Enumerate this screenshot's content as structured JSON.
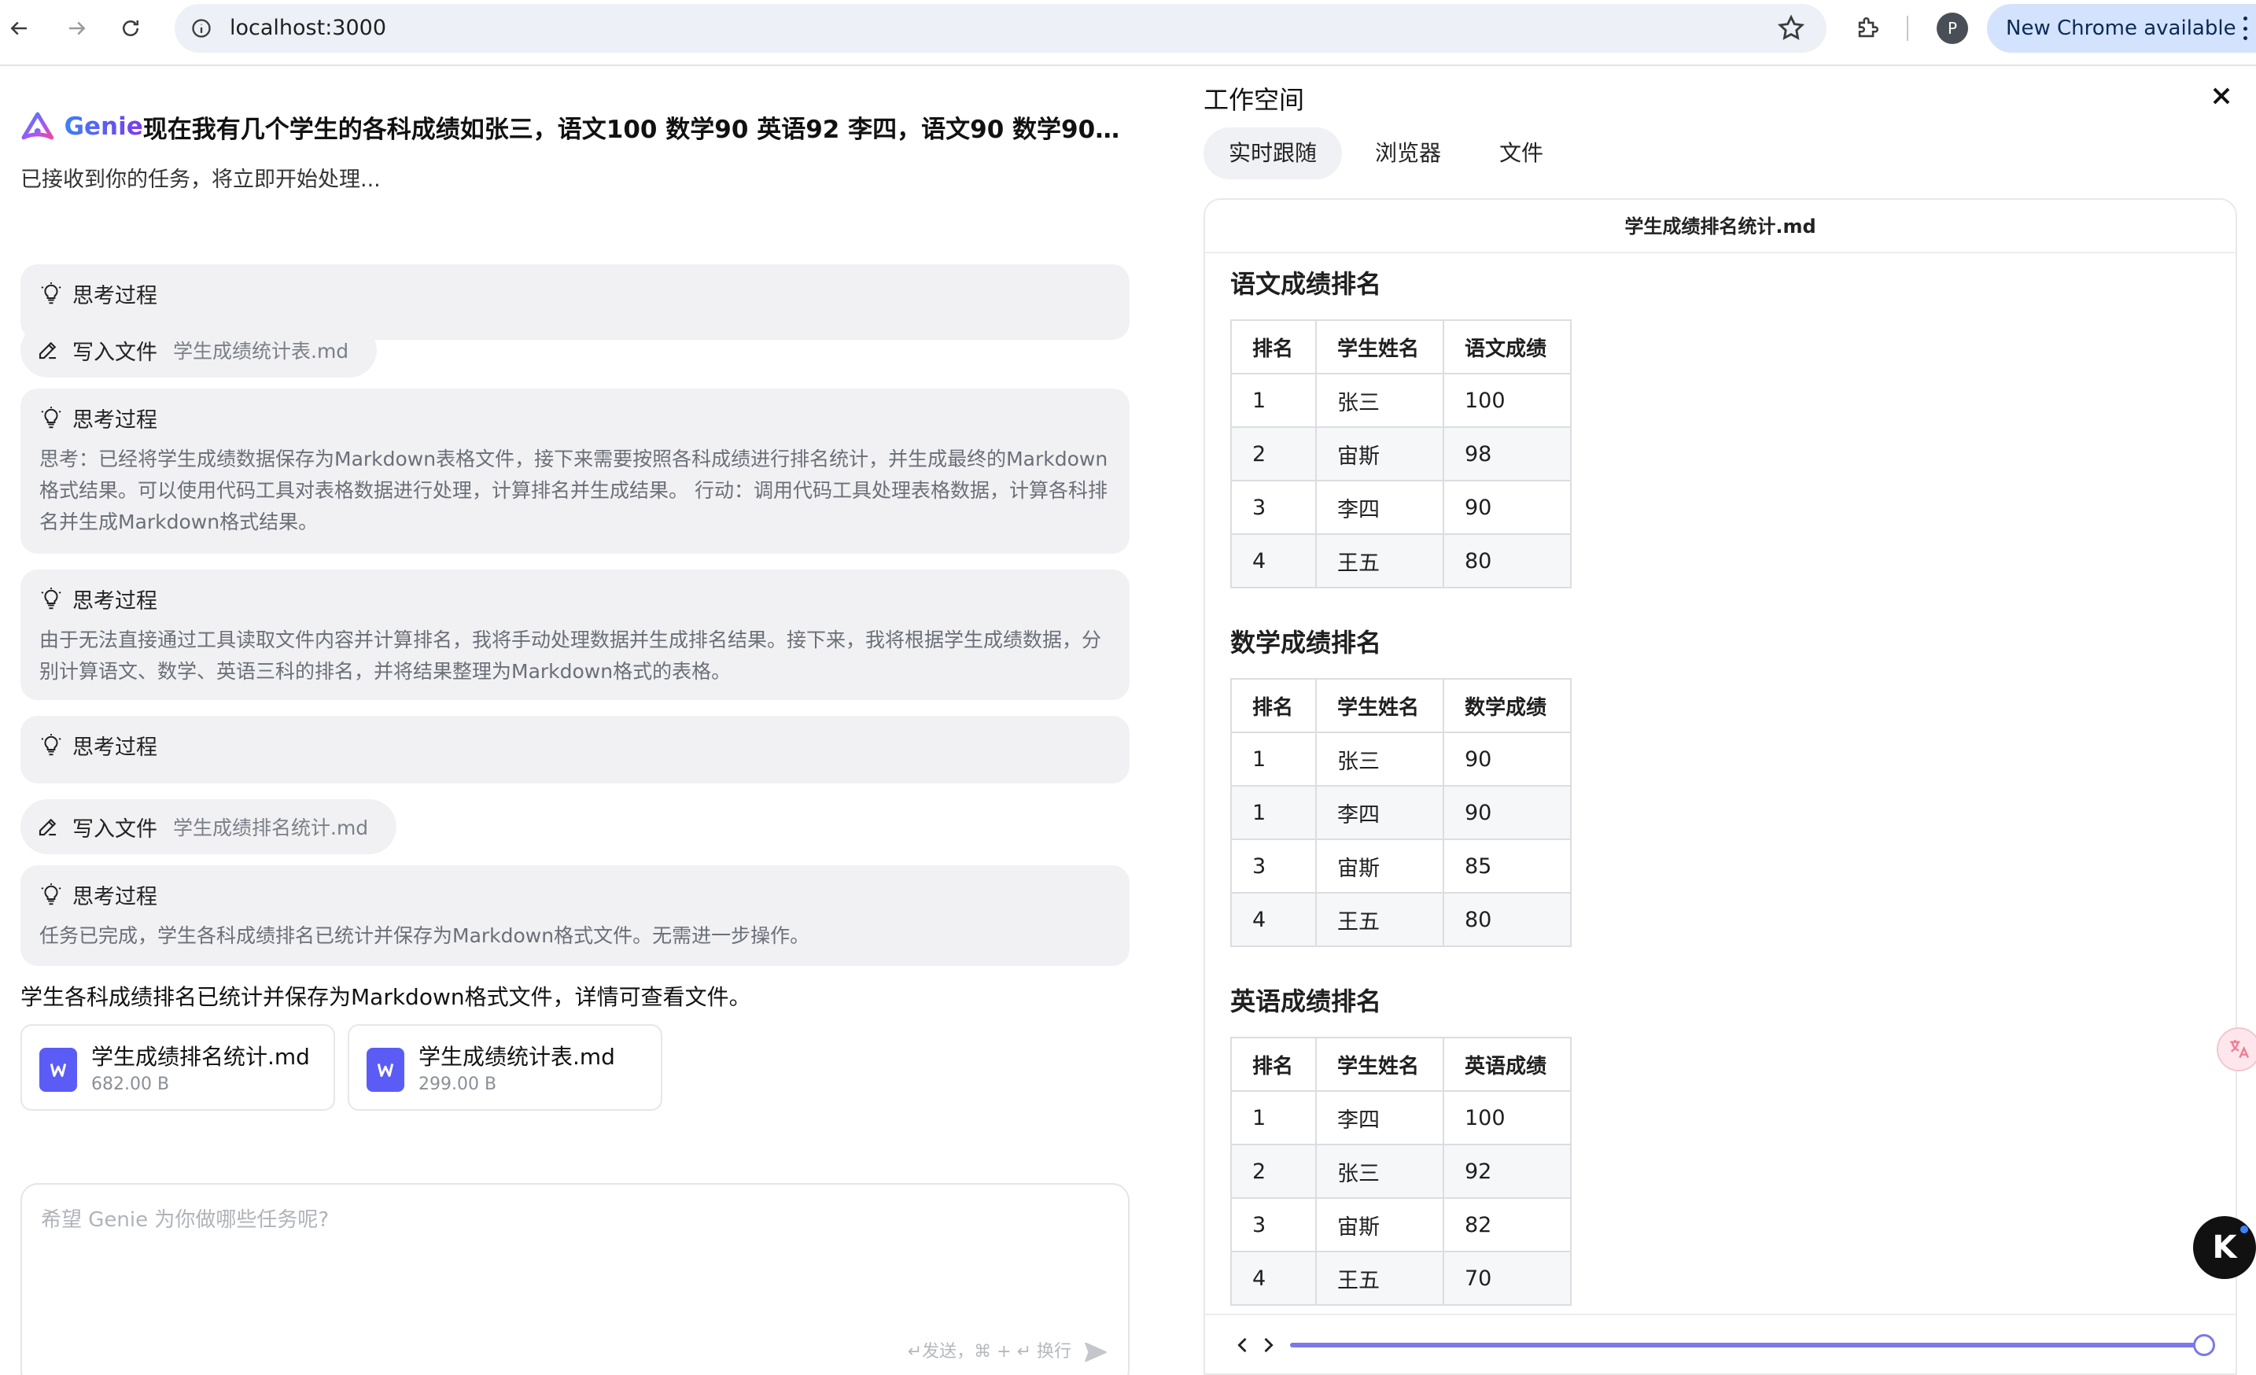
{
  "browser": {
    "url": "localhost:3000",
    "profile_initial": "P",
    "update_label": "New Chrome available"
  },
  "chat": {
    "brand": "Genie",
    "task_title": "现在我有几个学生的各科成绩如张三，语文100 数学90 英语92 李四，语文90 数学90 ...",
    "ack": "已接收到你的任务，将立即开始处理...",
    "thinking_label": "思考过程",
    "write_label": "写入文件",
    "steps": [
      {
        "type": "thinking",
        "body": ""
      },
      {
        "type": "write",
        "file": "学生成绩统计表.md"
      },
      {
        "type": "thinking",
        "body": "思考：已经将学生成绩数据保存为Markdown表格文件，接下来需要按照各科成绩进行排名统计，并生成最终的Markdown格式结果。可以使用代码工具对表格数据进行处理，计算排名并生成结果。 行动：调用代码工具处理表格数据，计算各科排名并生成Markdown格式结果。"
      },
      {
        "type": "thinking",
        "body": "由于无法直接通过工具读取文件内容并计算排名，我将手动处理数据并生成排名结果。接下来，我将根据学生成绩数据，分别计算语文、数学、英语三科的排名，并将结果整理为Markdown格式的表格。"
      },
      {
        "type": "thinking",
        "body": ""
      },
      {
        "type": "write",
        "file": "学生成绩排名统计.md"
      },
      {
        "type": "thinking",
        "body": "任务已完成，学生各科成绩排名已统计并保存为Markdown格式文件。无需进一步操作。"
      }
    ],
    "summary": "学生各科成绩排名已统计并保存为Markdown格式文件，详情可查看文件。",
    "files": [
      {
        "name": "学生成绩排名统计.md",
        "size": "682.00 B"
      },
      {
        "name": "学生成绩统计表.md",
        "size": "299.00 B"
      }
    ],
    "composer": {
      "placeholder": "希望 Genie 为你做哪些任务呢?",
      "hint": "↵发送，⌘ + ↵ 换行"
    }
  },
  "workspace": {
    "title": "工作空间",
    "tabs": [
      {
        "label": "实时跟随",
        "active": true
      },
      {
        "label": "浏览器",
        "active": false
      },
      {
        "label": "文件",
        "active": false
      }
    ],
    "file_title": "学生成绩排名统计.md",
    "progress": 1.0,
    "sections": [
      {
        "heading": "语文成绩排名",
        "headers": [
          "排名",
          "学生姓名",
          "语文成绩"
        ],
        "rows": [
          [
            "1",
            "张三",
            "100"
          ],
          [
            "2",
            "宙斯",
            "98"
          ],
          [
            "3",
            "李四",
            "90"
          ],
          [
            "4",
            "王五",
            "80"
          ]
        ]
      },
      {
        "heading": "数学成绩排名",
        "headers": [
          "排名",
          "学生姓名",
          "数学成绩"
        ],
        "rows": [
          [
            "1",
            "张三",
            "90"
          ],
          [
            "1",
            "李四",
            "90"
          ],
          [
            "3",
            "宙斯",
            "85"
          ],
          [
            "4",
            "王五",
            "80"
          ]
        ]
      },
      {
        "heading": "英语成绩排名",
        "headers": [
          "排名",
          "学生姓名",
          "英语成绩"
        ],
        "rows": [
          [
            "1",
            "李四",
            "100"
          ],
          [
            "2",
            "张三",
            "92"
          ],
          [
            "3",
            "宙斯",
            "82"
          ],
          [
            "4",
            "王五",
            "70"
          ]
        ]
      }
    ]
  },
  "icons": {
    "back": "arrow-left-icon",
    "forward": "arrow-right-icon",
    "reload": "reload-icon",
    "site_info": "info-icon",
    "bookmark": "star-icon",
    "extensions": "puzzle-icon",
    "thinking": "lightbulb-icon",
    "write": "pencil-icon",
    "file": "word-file-icon",
    "send": "send-icon",
    "close": "close-icon",
    "accent": "#7b78ea"
  }
}
